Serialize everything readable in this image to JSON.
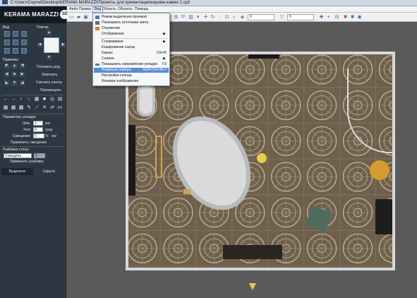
{
  "title_bar": {
    "path": "C:\\Users\\Сергей\\Desktop\\KERAMA MARAZZI\\Проекты для презентации\\керама камни 2.cp3"
  },
  "logo": {
    "text": "KERAMA MARAZZI",
    "badge": "3D"
  },
  "left_panel": {
    "view_label": "Вид",
    "tile_label": "Плитка",
    "preset_label": "Привязка",
    "actions": [
      "Положить ряд",
      "Заменить",
      "Сменить плитку",
      "Перемещать"
    ],
    "layout_section": "Параметры укладки",
    "shift_label": "Шов",
    "shift_value": "1",
    "shift_unit": "мм",
    "angle_label": "Угол",
    "angle_value": "0",
    "angle_unit": "град",
    "offset_label": "Смещение",
    "offset_value": "0",
    "offset_unit": "%",
    "offset_unit2": "мм",
    "apply_offset": "Применить смещение",
    "wall_split_label": "Разбивка стены",
    "wall_split_value": "Середина",
    "wall_split_num": "0",
    "apply_split": "Применить разбивку",
    "tab_selected": "Выделено",
    "tab_hidden": "Скрыто"
  },
  "menubar": {
    "items": [
      "Файл",
      "Правка",
      "Вид",
      "Область",
      "Объекты",
      "Помощь"
    ],
    "active": "Вид"
  },
  "toolbar": {
    "field1_value": "0",
    "field2_value": "0",
    "view3d_label": "3D"
  },
  "view_menu": {
    "items": [
      {
        "label": "Режим выделения проемов",
        "shortcut": ""
      },
      {
        "label": "Показывать источники света",
        "shortcut": ""
      },
      {
        "label": "Отражения",
        "shortcut": ""
      },
      {
        "label": "Отображение",
        "shortcut": ""
      },
      {
        "label": "Сглаживание",
        "shortcut": ""
      },
      {
        "label": "Кэширование сцены",
        "shortcut": ""
      },
      {
        "label": "Каркас",
        "shortcut": "Ctrl+K"
      },
      {
        "label": "Снимок",
        "shortcut": ""
      },
      {
        "label": "Показывать направление укладки",
        "shortcut": "F3"
      },
      {
        "label": "Анимация камеры",
        "shortcut": "Shift+Ctrl+Alt+I"
      },
      {
        "label": "Настройка солнца",
        "shortcut": ""
      },
      {
        "label": "Фоновое изображение",
        "shortcut": ""
      }
    ],
    "highlighted_index": 9
  },
  "colors": {
    "panel_bg": "#2d3742",
    "logo_bg": "#131a22",
    "menu_highlight": "#5a8ad6",
    "floor": "#6c5e4b",
    "tile_pattern": "#c9c0b1"
  }
}
